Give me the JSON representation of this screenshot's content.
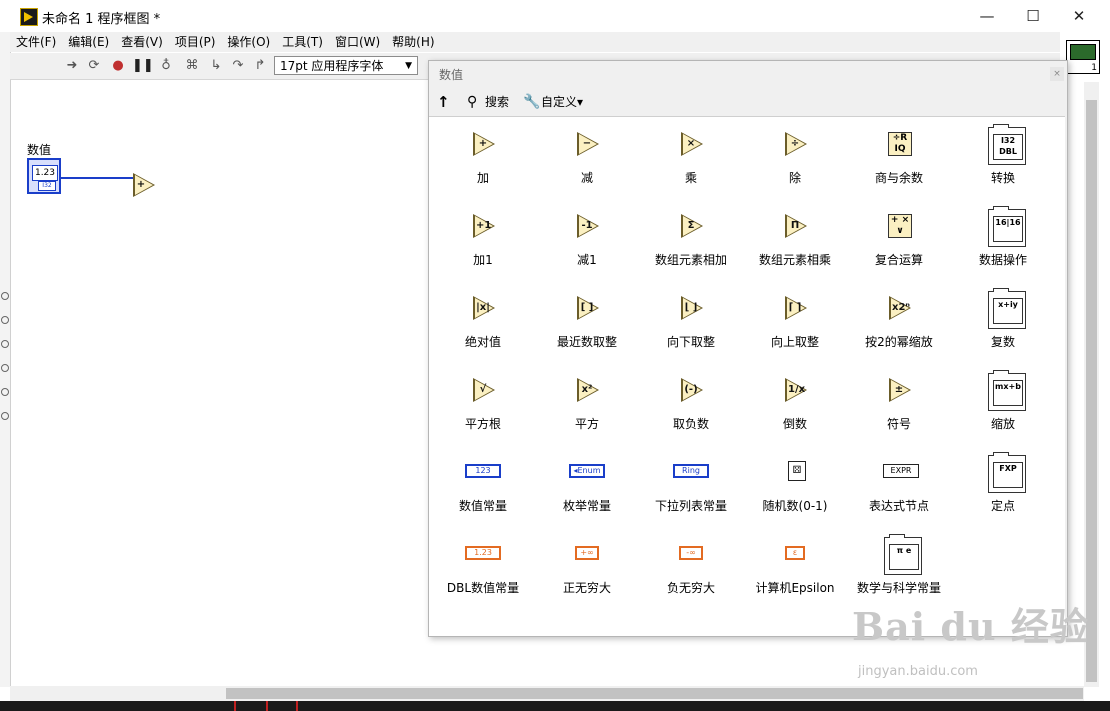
{
  "window": {
    "title": "未命名 1 程序框图 *",
    "minimize": "—",
    "maximize": "☐",
    "close": "✕"
  },
  "menubar": {
    "items": [
      "文件(F)",
      "编辑(E)",
      "查看(V)",
      "项目(P)",
      "操作(O)",
      "工具(T)",
      "窗口(W)",
      "帮助(H)"
    ]
  },
  "toolbar": {
    "font_select": "17pt 应用程序字体",
    "icons": [
      "run-arrow",
      "run-continuous",
      "abort",
      "pause",
      "highlight-bulb",
      "retain-wire",
      "step-into",
      "step-over",
      "step-out"
    ]
  },
  "thumbnail": {
    "number": "1"
  },
  "diagram": {
    "label": "数值",
    "terminal_value": "1.23",
    "terminal_type": "I32"
  },
  "palette": {
    "title": "数值",
    "close": "×",
    "toolbar": {
      "up": "↑",
      "search": "搜索",
      "customize": "自定义▾"
    },
    "items": [
      {
        "label": "加",
        "icon": "+",
        "kind": "tri"
      },
      {
        "label": "减",
        "icon": "−",
        "kind": "tri"
      },
      {
        "label": "乘",
        "icon": "×",
        "kind": "tri"
      },
      {
        "label": "除",
        "icon": "÷",
        "kind": "tri"
      },
      {
        "label": "商与余数",
        "icon": "÷R IQ",
        "kind": "sq"
      },
      {
        "label": "转换",
        "icon": "I32 DBL",
        "kind": "folder"
      },
      {
        "label": "加1",
        "icon": "+1",
        "kind": "tri"
      },
      {
        "label": "减1",
        "icon": "-1",
        "kind": "tri"
      },
      {
        "label": "数组元素相加",
        "icon": "Σ",
        "kind": "tri"
      },
      {
        "label": "数组元素相乘",
        "icon": "Π",
        "kind": "tri"
      },
      {
        "label": "复合运算",
        "icon": "+ × ∨",
        "kind": "sq"
      },
      {
        "label": "数据操作",
        "icon": "16|16",
        "kind": "folder"
      },
      {
        "label": "绝对值",
        "icon": "|x|",
        "kind": "tri"
      },
      {
        "label": "最近数取整",
        "icon": "[ ]",
        "kind": "tri"
      },
      {
        "label": "向下取整",
        "icon": "⌊ ⌋",
        "kind": "tri"
      },
      {
        "label": "向上取整",
        "icon": "⌈ ⌉",
        "kind": "tri"
      },
      {
        "label": "按2的幂缩放",
        "icon": "x2ⁿ",
        "kind": "tri"
      },
      {
        "label": "复数",
        "icon": "x+iy",
        "kind": "folder"
      },
      {
        "label": "平方根",
        "icon": "√",
        "kind": "tri"
      },
      {
        "label": "平方",
        "icon": "x²",
        "kind": "tri"
      },
      {
        "label": "取负数",
        "icon": "(-)",
        "kind": "tri"
      },
      {
        "label": "倒数",
        "icon": "1/x",
        "kind": "tri"
      },
      {
        "label": "符号",
        "icon": "±",
        "kind": "tri"
      },
      {
        "label": "缩放",
        "icon": "mx+b",
        "kind": "folder"
      },
      {
        "label": "数值常量",
        "icon": "123",
        "kind": "const-blue"
      },
      {
        "label": "枚举常量",
        "icon": "◂Enum",
        "kind": "const-blue"
      },
      {
        "label": "下拉列表常量",
        "icon": "Ring",
        "kind": "const-blue"
      },
      {
        "label": "随机数(0-1)",
        "icon": "⚄",
        "kind": "dice"
      },
      {
        "label": "表达式节点",
        "icon": "EXPR",
        "kind": "expr"
      },
      {
        "label": "定点",
        "icon": "FXP",
        "kind": "folder"
      },
      {
        "label": "DBL数值常量",
        "icon": "1.23",
        "kind": "const-orange"
      },
      {
        "label": "正无穷大",
        "icon": "+∞",
        "kind": "const-orange"
      },
      {
        "label": "负无穷大",
        "icon": "-∞",
        "kind": "const-orange"
      },
      {
        "label": "计算机Epsilon",
        "icon": "ε",
        "kind": "const-orange"
      },
      {
        "label": "数学与科学常量",
        "icon": "π e",
        "kind": "folder"
      }
    ]
  },
  "watermark": {
    "main": "Bai du 经验",
    "sub": "jingyan.baidu.com"
  }
}
